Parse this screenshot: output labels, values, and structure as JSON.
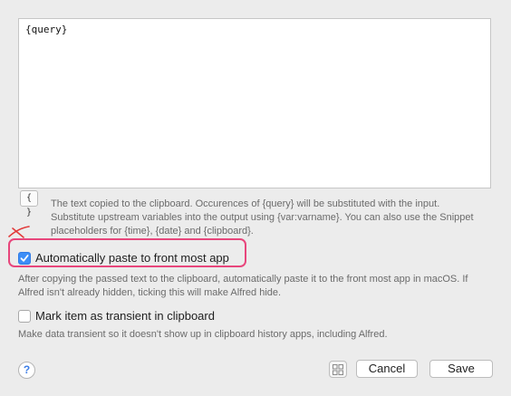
{
  "editor": {
    "value": "{query}"
  },
  "editor_toolbar": {
    "braces_label": "{ }"
  },
  "help": {
    "text_field": "The text copied to the clipboard. Occurences of {query} will be substituted with the input. Substitute upstream variables into the output using {var:varname}. You can also use the Snippet placeholders for {time}, {date} and {clipboard}.",
    "paste": "After copying the passed text to the clipboard, automatically paste it to the front most app in macOS. If Alfred isn't already hidden, ticking this will make Alfred hide.",
    "transient": "Make data transient so it doesn't show up in clipboard history apps, including Alfred."
  },
  "options": {
    "paste_label": "Automatically paste to front most app",
    "paste_checked": true,
    "transient_label": "Mark item as transient in clipboard",
    "transient_checked": false
  },
  "footer": {
    "help_label": "?",
    "cancel_label": "Cancel",
    "save_label": "Save"
  },
  "colors": {
    "accent": "#3d8ef7",
    "highlight": "#e8467c",
    "annotation_mark": "#e23a3a"
  }
}
